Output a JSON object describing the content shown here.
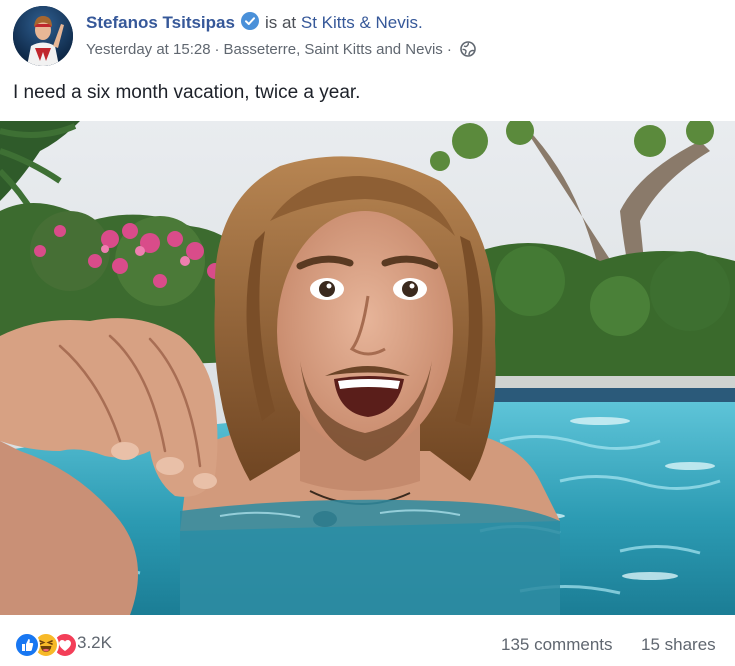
{
  "post": {
    "author": "Stefanos Tsitsipas",
    "at_text": "is at",
    "place": "St Kitts & Nevis.",
    "timestamp": "Yesterday at 15:28",
    "separator": "·",
    "location": "Basseterre, Saint Kitts and Nevis",
    "separator2": "·",
    "message": "I need a six month vacation, twice a year.",
    "reactions": [
      "like",
      "haha",
      "love"
    ],
    "reaction_count": "3.2K",
    "comments": "135 comments",
    "shares": "15 shares"
  },
  "colors": {
    "link": "#365899",
    "meta": "#606770",
    "verified": "#4a90d9",
    "like": "#1877f2",
    "haha": "#f7b928",
    "love": "#f33e58"
  },
  "icons": {
    "verified": "verified-badge-icon",
    "audience": "globe-icon"
  }
}
